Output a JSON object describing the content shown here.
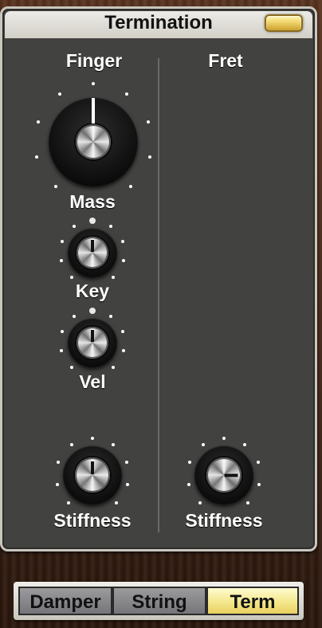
{
  "panel": {
    "title": "Termination",
    "led_color": "#f0d56a",
    "columns": [
      {
        "label": "Finger"
      },
      {
        "label": "Fret"
      }
    ],
    "finger_knobs": {
      "mass": "Mass",
      "key": "Key",
      "vel": "Vel",
      "stiffness": "Stiffness"
    },
    "fret_knobs": {
      "stiffness": "Stiffness"
    }
  },
  "tabs": [
    {
      "label": "Damper",
      "active": false
    },
    {
      "label": "String",
      "active": false
    },
    {
      "label": "Term",
      "active": true
    }
  ],
  "colors": {
    "panel": "#424240",
    "active_tab": "#f4e78c",
    "inactive_tab": "#8a8a8e"
  }
}
